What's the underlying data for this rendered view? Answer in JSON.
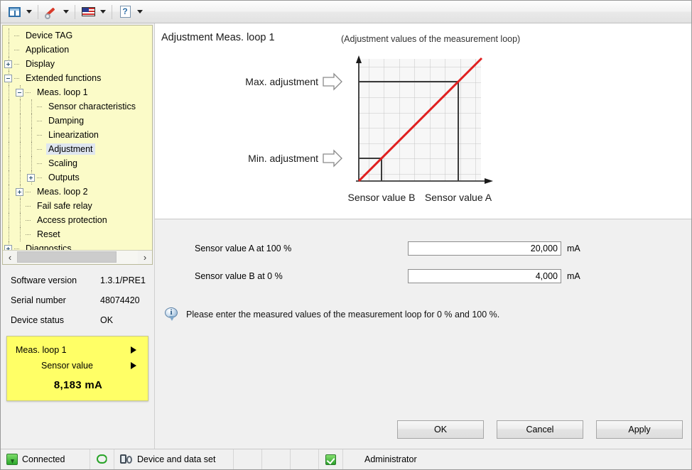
{
  "toolbar": {
    "buttons": [
      {
        "icon": "window-layout-icon",
        "has_dropdown": true
      },
      {
        "icon": "wrench-icon",
        "has_dropdown": true
      },
      {
        "icon": "language-flag-icon",
        "has_dropdown": true
      },
      {
        "icon": "help-question-icon",
        "has_dropdown": true
      }
    ],
    "help_glyph": "?"
  },
  "sidebar": {
    "tree": [
      {
        "label": "Device TAG",
        "depth": 1,
        "expander": "none",
        "selected": false
      },
      {
        "label": "Application",
        "depth": 1,
        "expander": "none",
        "selected": false
      },
      {
        "label": "Display",
        "depth": 1,
        "expander": "plus",
        "selected": false
      },
      {
        "label": "Extended functions",
        "depth": 1,
        "expander": "minus",
        "selected": false
      },
      {
        "label": "Meas. loop 1",
        "depth": 2,
        "expander": "minus",
        "selected": false
      },
      {
        "label": "Sensor characteristics",
        "depth": 3,
        "expander": "none",
        "selected": false
      },
      {
        "label": "Damping",
        "depth": 3,
        "expander": "none",
        "selected": false
      },
      {
        "label": "Linearization",
        "depth": 3,
        "expander": "none",
        "selected": false
      },
      {
        "label": "Adjustment",
        "depth": 3,
        "expander": "none",
        "selected": true
      },
      {
        "label": "Scaling",
        "depth": 3,
        "expander": "none",
        "selected": false
      },
      {
        "label": "Outputs",
        "depth": 3,
        "expander": "plus",
        "selected": false
      },
      {
        "label": "Meas. loop 2",
        "depth": 2,
        "expander": "plus",
        "selected": false
      },
      {
        "label": "Fail safe relay",
        "depth": 2,
        "expander": "none",
        "selected": false
      },
      {
        "label": "Access protection",
        "depth": 2,
        "expander": "none",
        "selected": false
      },
      {
        "label": "Reset",
        "depth": 2,
        "expander": "none",
        "selected": false
      },
      {
        "label": "Diagnostics",
        "depth": 1,
        "expander": "plus",
        "selected": false
      }
    ],
    "scrollbar": {
      "left_arrow": "‹",
      "right_arrow": "›"
    },
    "info": [
      {
        "key": "Software version",
        "value": "1.3.1/PRE1"
      },
      {
        "key": "Serial number",
        "value": "48074420"
      },
      {
        "key": "Device status",
        "value": "OK"
      }
    ],
    "meas_panel": {
      "row1": "Meas. loop 1",
      "row2": "Sensor value",
      "value": "8,183 mA"
    }
  },
  "main": {
    "title": "Adjustment Meas. loop 1",
    "subtitle": "(Adjustment values of the measurement loop)",
    "fields": [
      {
        "label": "Sensor value A at 100 %",
        "value": "20,000",
        "unit": "mA"
      },
      {
        "label": "Sensor value B at 0 %",
        "value": "4,000",
        "unit": "mA"
      }
    ],
    "hint": "Please enter the measured values of the measurement loop for 0 % and 100 %.",
    "buttons": [
      {
        "label": "OK"
      },
      {
        "label": "Cancel"
      },
      {
        "label": "Apply"
      }
    ]
  },
  "chart_data": {
    "type": "line",
    "title": "",
    "xlabel": "",
    "ylabel": "",
    "grid": true,
    "xlim": [
      0,
      8
    ],
    "ylim": [
      0,
      8
    ],
    "annotations": {
      "y_max_label": "Max. adjustment",
      "y_min_label": "Min. adjustment",
      "x_left_label": "Sensor value B",
      "x_right_label": "Sensor value A"
    },
    "series": [
      {
        "name": "adjustment-line",
        "color": "#e01f1f",
        "x": [
          0,
          8
        ],
        "y": [
          0,
          8
        ]
      }
    ],
    "markers": [
      {
        "name": "min-adjustment-point",
        "x": 1.5,
        "y": 1.5
      },
      {
        "name": "max-adjustment-point",
        "x": 6.5,
        "y": 6.5
      }
    ],
    "guide_lines": [
      {
        "name": "min-horizontal",
        "from": [
          0,
          1.5
        ],
        "to": [
          1.5,
          1.5
        ]
      },
      {
        "name": "min-vertical",
        "from": [
          1.5,
          0
        ],
        "to": [
          1.5,
          1.5
        ]
      },
      {
        "name": "max-horizontal",
        "from": [
          0,
          6.5
        ],
        "to": [
          6.5,
          6.5
        ]
      },
      {
        "name": "max-vertical",
        "from": [
          6.5,
          0
        ],
        "to": [
          6.5,
          6.5
        ]
      }
    ]
  },
  "statusbar": {
    "connection": "Connected",
    "sync_icon": "sync-icon",
    "dataset": "Device and data set",
    "user": "Administrator"
  }
}
